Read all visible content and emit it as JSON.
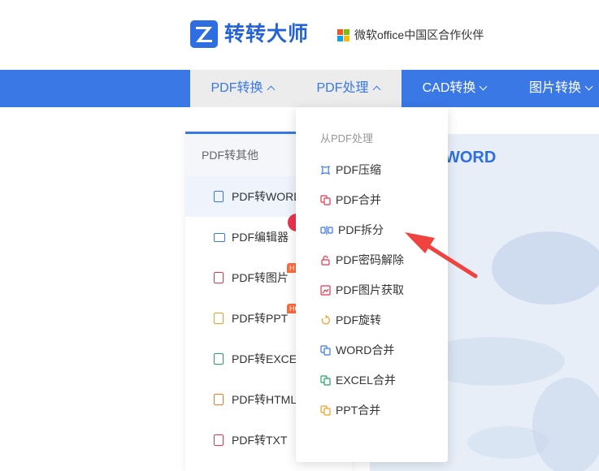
{
  "header": {
    "brand_name": "转转大师",
    "partner_text": "微软office中国区合作伙伴",
    "ms_colors": [
      "#f35325",
      "#81bc06",
      "#05a6f0",
      "#ffba08"
    ]
  },
  "nav": {
    "items": [
      {
        "label": "PDF转换",
        "state": "open"
      },
      {
        "label": "PDF处理",
        "state": "open"
      },
      {
        "label": "CAD转换",
        "state": "closed"
      },
      {
        "label": "图片转换",
        "state": "closed"
      }
    ]
  },
  "hero": {
    "title": "WORD"
  },
  "sidebar": {
    "heading": "PDF转其他",
    "items": [
      {
        "label": "PDF转WORD",
        "icon": "doc-icon",
        "color": "#3a78e6"
      },
      {
        "label": "PDF编辑器",
        "icon": "monitor-icon",
        "color": "#3a78e6"
      },
      {
        "label": "PDF转图片",
        "icon": "image-icon",
        "color": "#e9344e",
        "badge": "H"
      },
      {
        "label": "PDF转PPT",
        "icon": "ppt-icon",
        "color": "#f0a020",
        "badge": "HO"
      },
      {
        "label": "PDF转EXCEL",
        "icon": "excel-icon",
        "color": "#1fa463"
      },
      {
        "label": "PDF转HTML",
        "icon": "html-icon",
        "color": "#f07a20"
      },
      {
        "label": "PDF转TXT",
        "icon": "txt-icon",
        "color": "#e9344e"
      }
    ]
  },
  "dropdown": {
    "heading": "从PDF处理",
    "items": [
      {
        "label": "PDF压缩",
        "icon": "compress-icon",
        "color": "#3a78e6"
      },
      {
        "label": "PDF合并",
        "icon": "merge-icon",
        "color": "#e9344e"
      },
      {
        "label": "PDF拆分",
        "icon": "split-icon",
        "color": "#3a78e6"
      },
      {
        "label": "PDF密码解除",
        "icon": "unlock-icon",
        "color": "#e9344e"
      },
      {
        "label": "PDF图片获取",
        "icon": "image-extract-icon",
        "color": "#e9344e"
      },
      {
        "label": "PDF旋转",
        "icon": "rotate-icon",
        "color": "#f0a020"
      },
      {
        "label": "WORD合并",
        "icon": "word-merge-icon",
        "color": "#3a78e6"
      },
      {
        "label": "EXCEL合并",
        "icon": "excel-merge-icon",
        "color": "#1fa463"
      },
      {
        "label": "PPT合并",
        "icon": "ppt-merge-icon",
        "color": "#f0a020"
      }
    ]
  },
  "annotation": {
    "arrow_color": "#f0433f"
  }
}
